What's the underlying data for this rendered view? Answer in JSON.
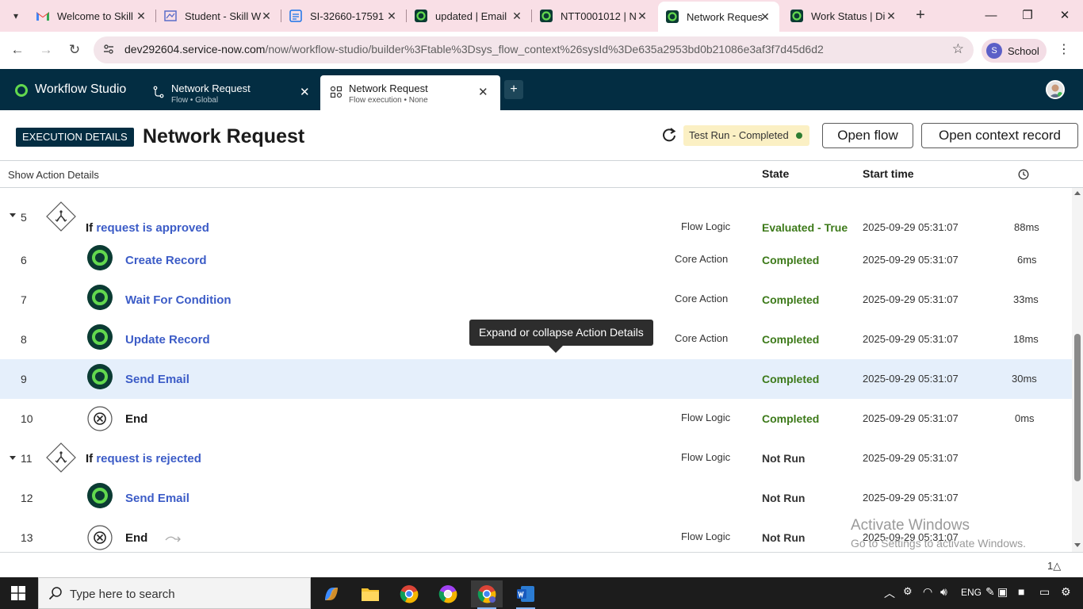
{
  "browser": {
    "tabs": [
      {
        "label": "Welcome to Skill",
        "icon": "gmail-icon"
      },
      {
        "label": "Student - Skill W",
        "icon": "skillwallet-icon"
      },
      {
        "label": "SI-32660-17591",
        "icon": "doc-icon"
      },
      {
        "label": "updated | Email",
        "icon": "servicenow-icon"
      },
      {
        "label": "NTT0001012 | N",
        "icon": "servicenow-icon"
      },
      {
        "label": "Network Reques",
        "icon": "servicenow-icon"
      },
      {
        "label": "Work Status | Di",
        "icon": "servicenow-icon"
      }
    ],
    "active_tab_index": 5,
    "url_host": "dev292604.service-now.com",
    "url_path": "/now/workflow-studio/builder%3Ftable%3Dsys_flow_context%26sysId%3De635a2953bd0b21086e3af3f7d45d6d2",
    "profile_initial": "S",
    "profile_label": "School"
  },
  "studio": {
    "app_title": "Workflow Studio",
    "tabs": [
      {
        "title": "Network Request",
        "subtitle": "Flow • Global"
      },
      {
        "title": "Network Request",
        "subtitle": "Flow execution • None"
      }
    ]
  },
  "page": {
    "badge": "EXECUTION DETAILS",
    "title": "Network Request",
    "run_status": "Test Run - Completed",
    "open_flow": "Open flow",
    "open_context": "Open context record"
  },
  "table": {
    "show_action_details": "Show Action Details",
    "col_state": "State",
    "col_start": "Start time",
    "rows": [
      {
        "num": "5",
        "kind": "if",
        "keyword": "If",
        "link": "request is approved",
        "type": "Flow Logic",
        "state": "Evaluated - True",
        "state_color": "green",
        "time": "2025-09-29 05:31:07",
        "dur": "88ms"
      },
      {
        "num": "6",
        "kind": "action",
        "label": "Create Record",
        "type": "Core Action",
        "state": "Completed",
        "state_color": "green",
        "time": "2025-09-29 05:31:07",
        "dur": "6ms"
      },
      {
        "num": "7",
        "kind": "action",
        "label": "Wait For Condition",
        "type": "Core Action",
        "state": "Completed",
        "state_color": "green",
        "time": "2025-09-29 05:31:07",
        "dur": "33ms"
      },
      {
        "num": "8",
        "kind": "action",
        "label": "Update Record",
        "type": "Core Action",
        "state": "Completed",
        "state_color": "green",
        "time": "2025-09-29 05:31:07",
        "dur": "18ms"
      },
      {
        "num": "9",
        "kind": "action",
        "label": "Send Email",
        "type": "",
        "state": "Completed",
        "state_color": "green",
        "time": "2025-09-29 05:31:07",
        "dur": "30ms"
      },
      {
        "num": "10",
        "kind": "end",
        "label": "End",
        "type": "Flow Logic",
        "state": "Completed",
        "state_color": "green",
        "time": "2025-09-29 05:31:07",
        "dur": "0ms"
      },
      {
        "num": "11",
        "kind": "if",
        "keyword": "If",
        "link": "request is rejected",
        "type": "Flow Logic",
        "state": "Not Run",
        "state_color": "dark",
        "time": "2025-09-29 05:31:07",
        "dur": ""
      },
      {
        "num": "12",
        "kind": "action",
        "label": "Send Email",
        "type": "",
        "state": "Not Run",
        "state_color": "dark",
        "time": "2025-09-29 05:31:07",
        "dur": ""
      },
      {
        "num": "13",
        "kind": "end",
        "label": "End",
        "type": "Flow Logic",
        "state": "Not Run",
        "state_color": "dark",
        "time": "2025-09-29 05:31:07",
        "dur": ""
      }
    ],
    "highlighted_row_index": 4
  },
  "tooltip": "Expand or collapse Action Details",
  "footer_count": "1",
  "watermark": {
    "line1": "Activate Windows",
    "line2": "Go to Settings to activate Windows."
  },
  "taskbar": {
    "search_placeholder": "Type here to search",
    "lang": "ENG"
  },
  "colors": {
    "studio_header": "#032d42",
    "link": "#3c5cc7",
    "state_green": "#3d7a1a",
    "highlight_row": "#e5effb",
    "run_status_bg": "#fbf0c4"
  }
}
